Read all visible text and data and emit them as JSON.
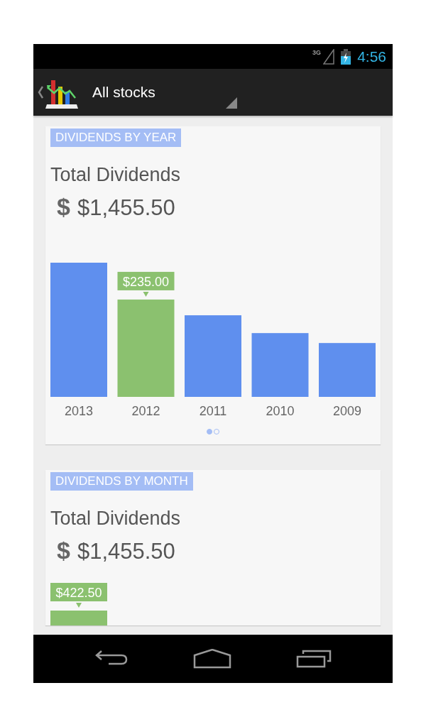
{
  "status_bar": {
    "network": "3G",
    "time": "4:56"
  },
  "action_bar": {
    "title": "All stocks"
  },
  "cards": [
    {
      "header": "DIVIDENDS BY YEAR",
      "title": "Total Dividends",
      "currency_symbol": "$",
      "total": "$1,455.50",
      "pager": [
        {
          "selected": true
        },
        {
          "selected": false
        }
      ],
      "chart_data": {
        "type": "bar",
        "categories": [
          "2013",
          "2012",
          "2011",
          "2010",
          "2009"
        ],
        "values": [
          324,
          235,
          197,
          154,
          130
        ],
        "value_labels": [
          null,
          "$235.00",
          null,
          null,
          null
        ]
      }
    },
    {
      "header": "DIVIDENDS BY MONTH",
      "title": "Total Dividends",
      "currency_symbol": "$",
      "total": "$1,455.50",
      "bar_label": "$422.50"
    }
  ]
}
